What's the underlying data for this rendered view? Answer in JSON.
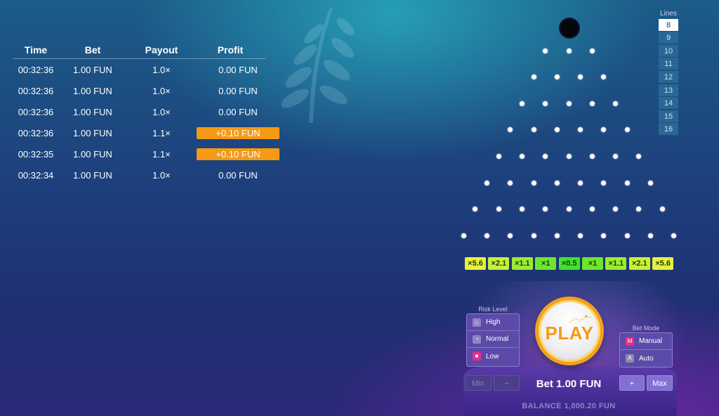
{
  "history": {
    "headers": {
      "time": "Time",
      "bet": "Bet",
      "payout": "Payout",
      "profit": "Profit"
    },
    "rows": [
      {
        "time": "00:32:36",
        "bet": "1.00 FUN",
        "payout": "1.0×",
        "profit": "0.00 FUN",
        "win": false
      },
      {
        "time": "00:32:36",
        "bet": "1.00 FUN",
        "payout": "1.0×",
        "profit": "0.00 FUN",
        "win": false
      },
      {
        "time": "00:32:36",
        "bet": "1.00 FUN",
        "payout": "1.0×",
        "profit": "0.00 FUN",
        "win": false
      },
      {
        "time": "00:32:36",
        "bet": "1.00 FUN",
        "payout": "1.1×",
        "profit": "+0.10 FUN",
        "win": true
      },
      {
        "time": "00:32:35",
        "bet": "1.00 FUN",
        "payout": "1.1×",
        "profit": "+0.10 FUN",
        "win": true
      },
      {
        "time": "00:32:34",
        "bet": "1.00 FUN",
        "payout": "1.0×",
        "profit": "0.00 FUN",
        "win": false
      }
    ]
  },
  "lines": {
    "label": "Lines",
    "options": [
      "8",
      "9",
      "10",
      "11",
      "12",
      "13",
      "14",
      "15",
      "16"
    ],
    "selected": "8"
  },
  "multipliers": [
    {
      "label": "×5.6",
      "color": "#e8f03c"
    },
    {
      "label": "×2.1",
      "color": "#c6f03a"
    },
    {
      "label": "×1.1",
      "color": "#9cec30"
    },
    {
      "label": "×1",
      "color": "#6ee62c"
    },
    {
      "label": "×0.5",
      "color": "#3ee42c"
    },
    {
      "label": "×1",
      "color": "#6ee62c"
    },
    {
      "label": "×1.1",
      "color": "#9cec30"
    },
    {
      "label": "×2.1",
      "color": "#c6f03a"
    },
    {
      "label": "×5.6",
      "color": "#e8f03c"
    }
  ],
  "risk": {
    "title": "Risk Level",
    "options": [
      {
        "label": "High",
        "icon": "flame-icon"
      },
      {
        "label": "Normal",
        "icon": "gauge-icon"
      },
      {
        "label": "Low",
        "icon": "lock-icon"
      }
    ]
  },
  "mode": {
    "title": "Bet Mode",
    "options": [
      {
        "label": "Manual",
        "badge": "M",
        "icon": "manual-icon"
      },
      {
        "label": "Auto",
        "badge": "A",
        "icon": "auto-icon"
      }
    ]
  },
  "play_label": "PLAY",
  "controls": {
    "min": "Min",
    "minus": "−",
    "plus": "+",
    "max": "Max"
  },
  "bet_amount": "Bet 1.00 FUN",
  "balance": "BALANCE 1,000.20 FUN",
  "colors": {
    "accent": "#f59a14",
    "panel": "#5c4aa8",
    "lines_bg": "#2a6796"
  }
}
